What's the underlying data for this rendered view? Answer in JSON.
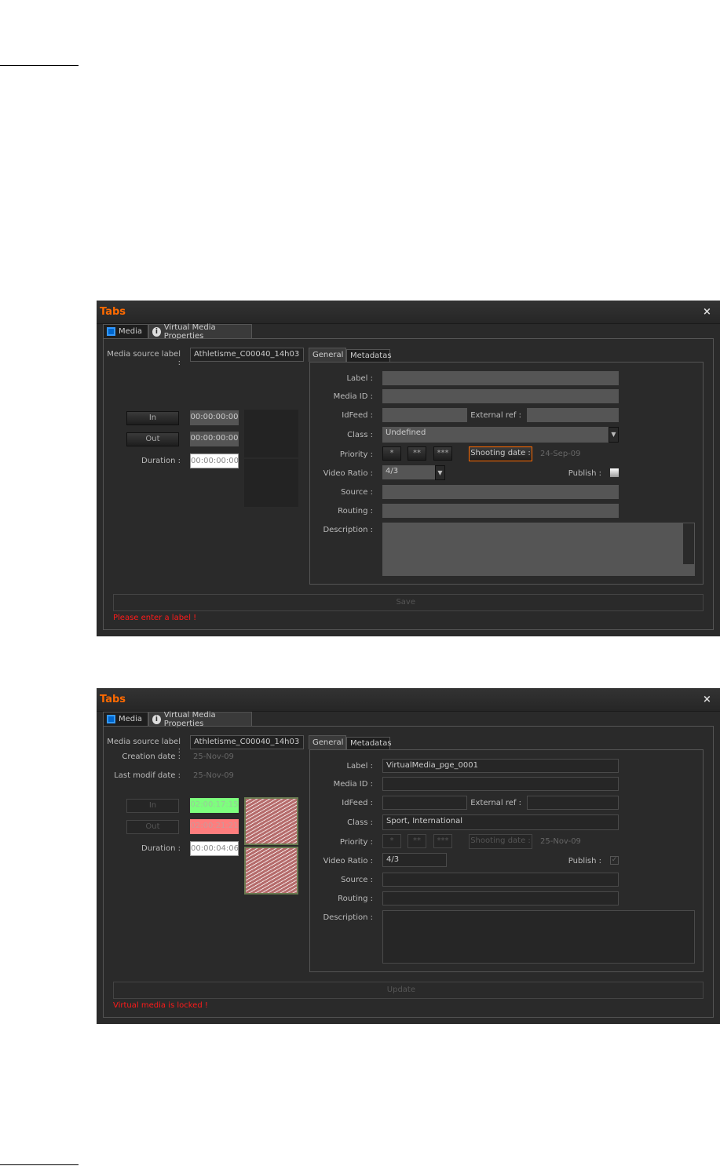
{
  "panels": [
    {
      "title": "Tabs",
      "tabs": [
        "Media",
        "Virtual Media Properties"
      ],
      "media_source_label": "Media source label :",
      "media_source_value": "Athletisme_C00040_14h03",
      "creation_label": "",
      "creation_value": "",
      "modif_label": "",
      "modif_value": "",
      "in_label": "In",
      "in_value": "00:00:00:00",
      "out_label": "Out",
      "out_value": "00:00:00:00",
      "duration_label": "Duration :",
      "duration_value": "00:00:00:00",
      "subtabs": [
        "General",
        "Metadatas"
      ],
      "labels": {
        "label": "Label :",
        "media_id": "Media ID :",
        "idfeed": "IdFeed :",
        "external_ref": "External ref :",
        "class": "Class :",
        "priority": "Priority :",
        "video_ratio": "Video Ratio :",
        "publish": "Publish :",
        "source": "Source :",
        "routing": "Routing :",
        "description": "Description :"
      },
      "values": {
        "label": "",
        "media_id": "",
        "idfeed": "",
        "external_ref": "",
        "class": "Undefined",
        "video_ratio": "4/3",
        "source": "",
        "routing": "",
        "description": "",
        "publish": false
      },
      "priority_buttons": [
        "*",
        "**",
        "***"
      ],
      "shooting_date_label": "Shooting date :",
      "shooting_date": "24-Sep-09",
      "action_label": "Save",
      "message": "Please enter a label !"
    },
    {
      "title": "Tabs",
      "tabs": [
        "Media",
        "Virtual Media Properties"
      ],
      "media_source_label": "Media source label :",
      "media_source_value": "Athletisme_C00040_14h03",
      "creation_label": "Creation date :",
      "creation_value": "25-Nov-09",
      "modif_label": "Last modif date :",
      "modif_value": "25-Nov-09",
      "in_label": "In",
      "in_value": "02:00:17:15",
      "out_label": "Out",
      "out_value": "02:00:21:21",
      "duration_label": "Duration :",
      "duration_value": "00:00:04:06",
      "subtabs": [
        "General",
        "Metadatas"
      ],
      "labels": {
        "label": "Label :",
        "media_id": "Media ID :",
        "idfeed": "IdFeed :",
        "external_ref": "External ref :",
        "class": "Class :",
        "priority": "Priority :",
        "video_ratio": "Video Ratio :",
        "publish": "Publish :",
        "source": "Source :",
        "routing": "Routing :",
        "description": "Description :"
      },
      "values": {
        "label": "VirtualMedia_pge_0001",
        "media_id": "",
        "idfeed": "",
        "external_ref": "",
        "class": "Sport, International",
        "video_ratio": "4/3",
        "source": "",
        "routing": "",
        "description": "",
        "publish": true
      },
      "priority_buttons": [
        "*",
        "**",
        "***"
      ],
      "shooting_date_label": "Shooting date :",
      "shooting_date": "25-Nov-09",
      "action_label": "Update",
      "message": "Virtual media is locked !"
    }
  ],
  "colors": {
    "accent": "#ff6a00",
    "error": "#ff1a1a",
    "in_mark": "#7dff7d",
    "out_mark": "#ff7d7d"
  }
}
